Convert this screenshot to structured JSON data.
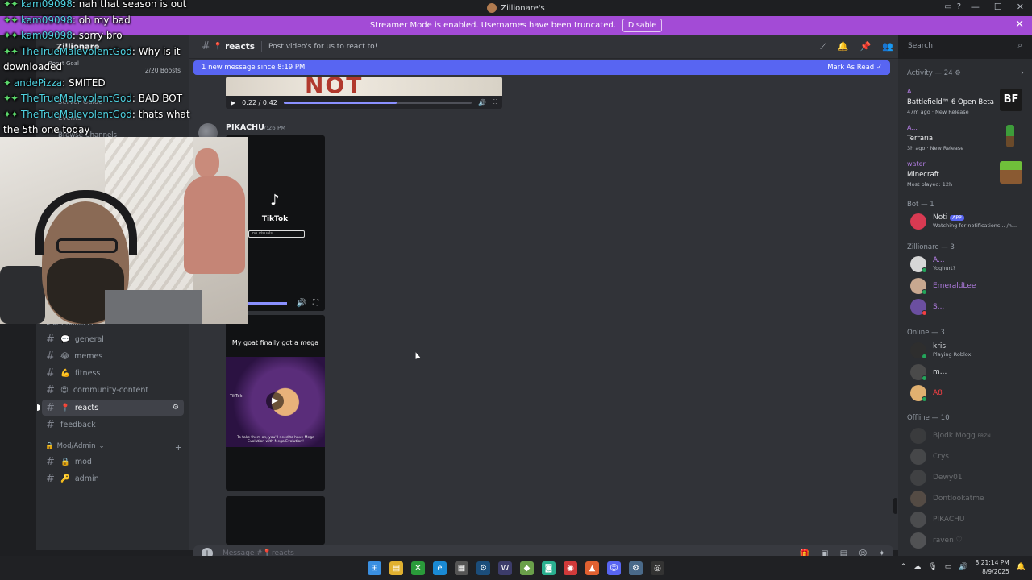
{
  "window": {
    "title": "Zillionare's"
  },
  "banner": {
    "text": "Streamer Mode is enabled. Usernames have been truncated.",
    "disable_label": "Disable"
  },
  "sidebar": {
    "server_name": "Zillionare",
    "boost_goal": "Boost Goal",
    "boost_count": "2/20 Boosts",
    "links": [
      "Server Guide",
      "Events",
      "Browse Channels"
    ],
    "category_text": "Text Channels",
    "channels": [
      {
        "emoji": "💬",
        "name": "general"
      },
      {
        "emoji": "😂",
        "name": "memes"
      },
      {
        "emoji": "💪",
        "name": "fitness"
      },
      {
        "emoji": "😍",
        "name": "community-content"
      },
      {
        "emoji": "📍",
        "name": "reacts"
      },
      {
        "emoji": "",
        "name": "feedback"
      }
    ],
    "category_mod": "Mod/Admin",
    "mod_channels": [
      {
        "emoji": "🔒",
        "name": "mod"
      },
      {
        "emoji": "🔑",
        "name": "admin"
      }
    ]
  },
  "chat_header": {
    "channel_emoji": "📍",
    "channel_name": "reacts",
    "topic": "Post video's for us to react to!"
  },
  "search": {
    "placeholder": "Search"
  },
  "chat": {
    "new_message_text": "1 new message since 8:19 PM",
    "mark_read_label": "Mark As Read",
    "video": {
      "time": "0:22 / 0:42",
      "progress": 0.6
    },
    "message": {
      "author": "PIKACHU",
      "time": "7:26 PM"
    },
    "tiktok1": {
      "brand": "TikTok",
      "search_text": "no visuals"
    },
    "tiktok2": {
      "caption": "My goat finally got a mega",
      "thumb_label": "TikTok",
      "thumb_note": "To take them on, you'll need to have Mega Evolution with Mega Evolution!"
    },
    "composer_placeholder": "Message #📍reacts"
  },
  "members": {
    "activity_header": "Activity — 24",
    "activities": [
      {
        "who": "A...",
        "game": "Battlefield™ 6 Open Beta",
        "meta": "47m ago · New Release",
        "thumb_color": "#1a1a1a",
        "thumb_text": "BF"
      },
      {
        "who": "A...",
        "game": "Terraria",
        "meta": "3h ago · New Release",
        "thumb_color": "#3d4a5c",
        "thumb_text": ""
      },
      {
        "who": "water",
        "game": "Minecraft",
        "meta": "Most played: 12h",
        "thumb_color": "#5e9c3a",
        "thumb_text": ""
      }
    ],
    "bot_header": "Bot — 1",
    "bot": {
      "name": "Noti",
      "badge": "APP",
      "sub": "Watching for notifications... /h..."
    },
    "role_header": "Zillionare — 3",
    "role_members": [
      {
        "name": "A...",
        "sub": "Yoghurt?",
        "color": "#b07ce0",
        "av": "#d7d7d7",
        "status": "#23a55a"
      },
      {
        "name": "EmeraldLee",
        "sub": "",
        "color": "#b07ce0",
        "av": "#c8a890",
        "status": "#23a55a"
      },
      {
        "name": "S...",
        "sub": "",
        "color": "#b07ce0",
        "av": "#6b4fa0",
        "status": "#f23f43"
      }
    ],
    "online_header": "Online — 3",
    "online_members": [
      {
        "name": "kris",
        "sub": "Playing Roblox",
        "color": "#dbdee1",
        "av": "#2e2e2e",
        "status": "#23a55a"
      },
      {
        "name": "m...",
        "sub": "",
        "color": "#dbdee1",
        "av": "#4a4a4a",
        "status": "#23a55a"
      },
      {
        "name": "A8",
        "sub": "",
        "color": "#f23f43",
        "av": "#e0b070",
        "status": "#23a55a"
      }
    ],
    "offline_header": "Offline — 10",
    "offline_members": [
      {
        "name": "Bjodk Mogg",
        "sub": "",
        "tag": "FRZN",
        "av": "#555"
      },
      {
        "name": "Crys",
        "sub": "",
        "tag": "",
        "av": "#777"
      },
      {
        "name": "Dewy01",
        "sub": "",
        "tag": "",
        "av": "#666"
      },
      {
        "name": "Dontlookatme",
        "sub": "",
        "tag": "",
        "av": "#a0856a"
      },
      {
        "name": "PIKACHU",
        "sub": "",
        "tag": "",
        "av": "#888"
      },
      {
        "name": "raven ♡",
        "sub": "",
        "tag": "",
        "av": "#999"
      }
    ]
  },
  "stream_chat": [
    {
      "user": "kam09098",
      "text": "nah that season is out"
    },
    {
      "user": "kam09098",
      "text": "oh my bad"
    },
    {
      "user": "kam09098",
      "text": "sorry bro"
    },
    {
      "user": "TheTrueMalevolentGod",
      "text": "Why is it downloaded"
    },
    {
      "user": "andePizza",
      "text": "SMITED"
    },
    {
      "user": "TheTrueMalevolentGod",
      "text": "BAD BOT"
    },
    {
      "user": "TheTrueMalevolentGod",
      "text": "thats what the 5th one today"
    }
  ],
  "taskbar": {
    "time": "8:21:14 PM",
    "date": "8/9/2025"
  },
  "colors": {
    "banner": "#a34bd6",
    "accent": "#5865f2",
    "online": "#23a55a"
  }
}
